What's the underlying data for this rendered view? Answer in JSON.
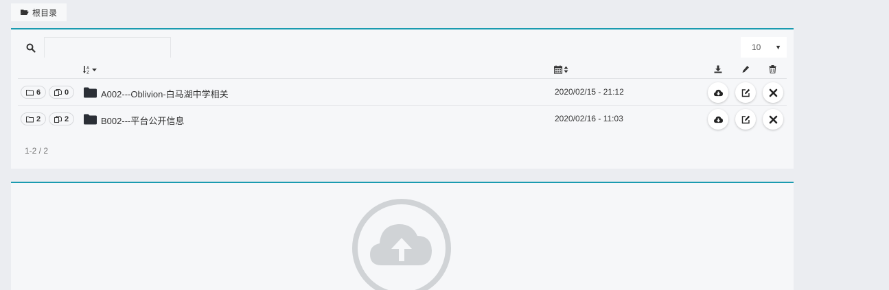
{
  "breadcrumb": {
    "icon": "folder-open-icon",
    "label": "根目录"
  },
  "toolbar": {
    "search_icon": "search-icon",
    "search_value": "",
    "page_size": "10"
  },
  "columns": {
    "name_sort_icon": "sort-alpha-icon",
    "date_sort_icon": "calendar-sort-icon",
    "download_icon": "download-icon",
    "edit_icon": "pencil-icon",
    "delete_icon": "trash-icon"
  },
  "rows": [
    {
      "folders": "6",
      "files": "0",
      "name": "A002---Oblivion-白马湖中学相关",
      "date": "2020/02/15 - 21:12"
    },
    {
      "folders": "2",
      "files": "2",
      "name": "B002---平台公开信息",
      "date": "2020/02/16 - 11:03"
    }
  ],
  "pager": {
    "text": "1-2 / 2"
  },
  "upload": {
    "icon": "cloud-upload-icon"
  },
  "colors": {
    "accent": "#1a9bb0",
    "panel_bg": "#f6f7f9",
    "page_bg": "#ebedf1",
    "folder": "#2b2f36",
    "upload_icon": "#d0d3d6"
  }
}
